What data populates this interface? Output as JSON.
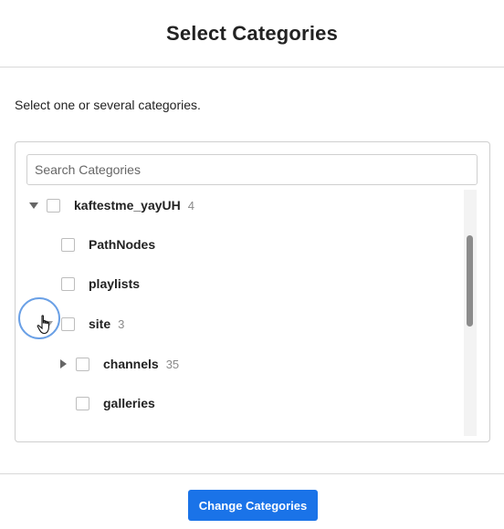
{
  "dialog": {
    "title": "Select Categories",
    "instructions": "Select one or several categories."
  },
  "search": {
    "placeholder": "Search Categories",
    "value": ""
  },
  "tree": {
    "nodes": [
      {
        "label": "kaftestme_yayUH",
        "count": "4",
        "expanded": true,
        "level": 0
      },
      {
        "label": "PathNodes",
        "count": "",
        "level": 1
      },
      {
        "label": "playlists",
        "count": "",
        "level": 1
      },
      {
        "label": "site",
        "count": "3",
        "expanded": true,
        "level": 1
      },
      {
        "label": "channels",
        "count": "35",
        "expanded": false,
        "level": 2
      },
      {
        "label": "galleries",
        "count": "",
        "level": 2
      }
    ]
  },
  "footer": {
    "primary_button_label": "Change Categories"
  },
  "colors": {
    "primary": "#1a73e8",
    "border": "#cfcfcf",
    "muted_text": "#8a8a8a",
    "cursor_ring": "#6aa0e6"
  }
}
